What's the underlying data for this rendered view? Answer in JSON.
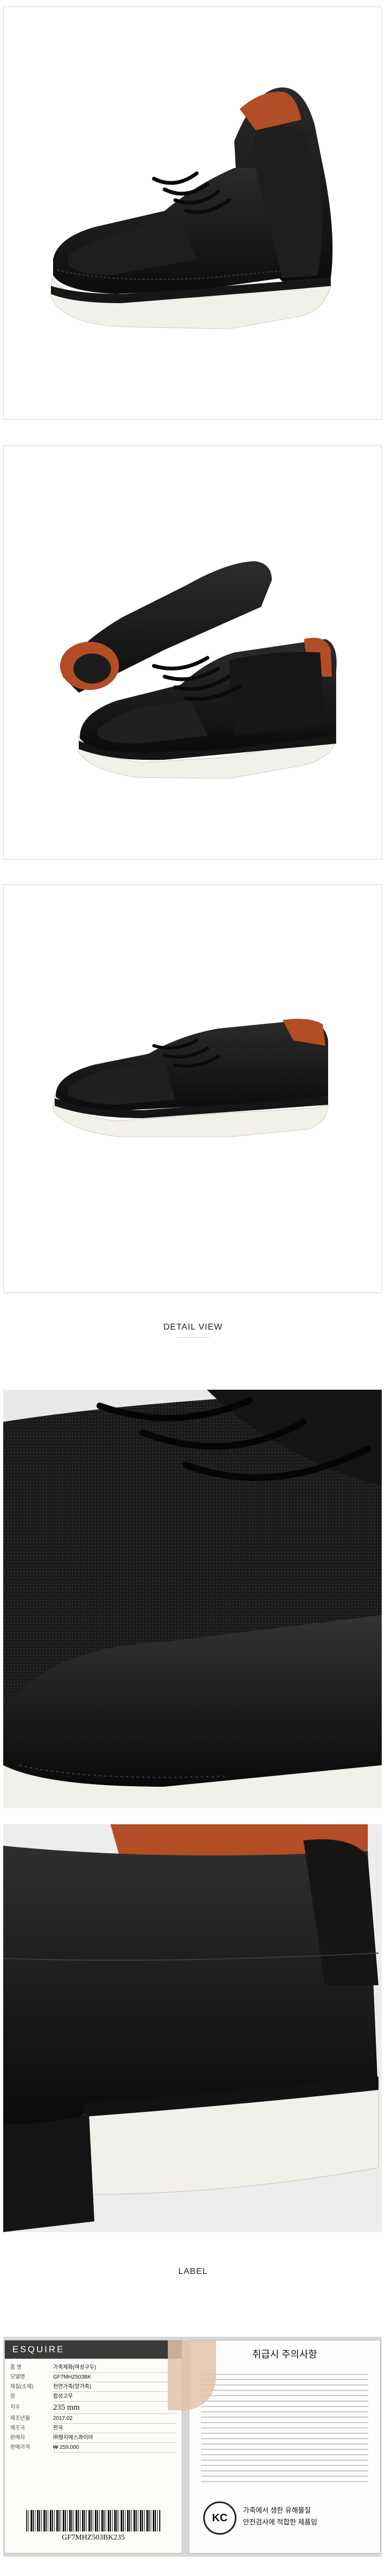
{
  "section_headings": {
    "detail": "DETAIL VIEW",
    "label": "LABEL"
  },
  "product_tag": {
    "brand": "ESQUIRE",
    "rows": [
      {
        "key": "품   명",
        "value": "가죽제화(여성구두)"
      },
      {
        "key": "모델명",
        "value": "GF7MHZ503BK"
      },
      {
        "key": "재질(소재)",
        "value": "천연가죽(양가죽)"
      },
      {
        "key": "창",
        "value": "합성고무"
      },
      {
        "key": "치수",
        "value": "235 mm"
      },
      {
        "key": "제조년월",
        "value": "2017.02"
      },
      {
        "key": "제조국",
        "value": "한국"
      },
      {
        "key": "판매자",
        "value": "㈜형지에스콰이아"
      },
      {
        "key": "판매가격",
        "value": "₩ 259,000"
      }
    ],
    "barcode_text": "GF7MHZ503BK235"
  },
  "care_card": {
    "title": "취급시 주의사항",
    "kc_text": "KC",
    "footer_lines": [
      "가죽에서 생한 유해물질",
      "안전검사에 적합한 제품임"
    ]
  },
  "colors": {
    "leather": "#121212",
    "mesh": "#1e1e1e",
    "sole": "#f2f0ea",
    "lining": "#b34d25",
    "frame": "#d9d9d9"
  }
}
